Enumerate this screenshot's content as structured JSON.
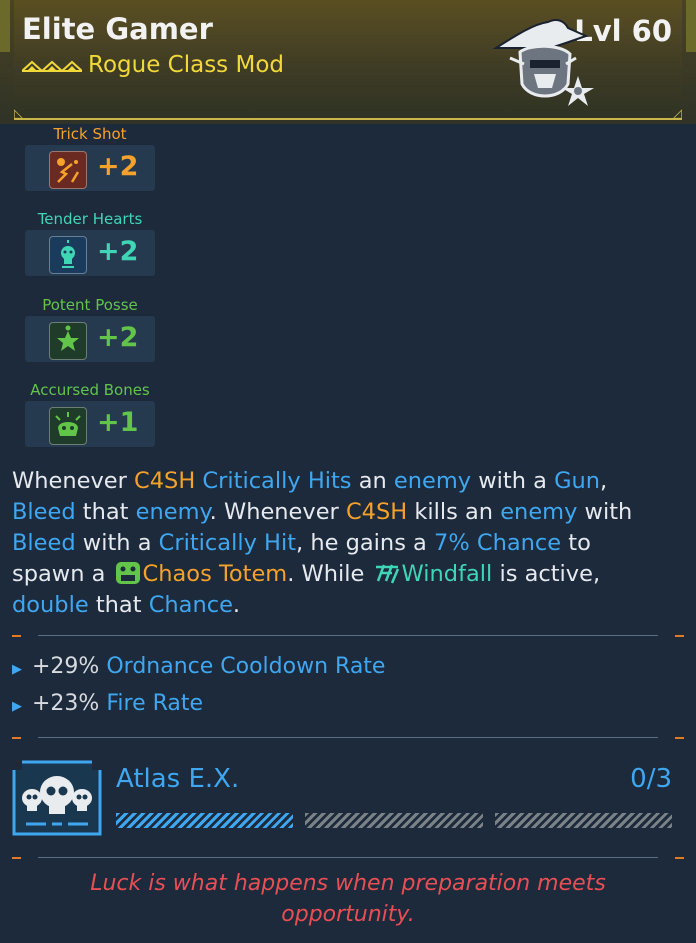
{
  "header": {
    "item_name": "Elite Gamer",
    "item_type": "Rogue Class Mod",
    "level": "Lvl 60",
    "rarity_icon": "chevron-rarity-icon",
    "portrait_icon": "robot-cowboy-portrait-icon",
    "accent_color": "#f1d93a"
  },
  "skills": [
    {
      "name": "Trick Shot",
      "value": "+2",
      "icon": "trick-shot-icon",
      "color": "#f6a12a"
    },
    {
      "name": "Tender Hearts",
      "value": "+2",
      "icon": "tender-hearts-icon",
      "color": "#3fd6b6"
    },
    {
      "name": "Potent Posse",
      "value": "+2",
      "icon": "potent-posse-icon",
      "color": "#62c54a"
    },
    {
      "name": "Accursed Bones",
      "value": "+1",
      "icon": "accursed-bones-icon",
      "color": "#62c54a"
    }
  ],
  "description": {
    "parts": [
      "Whenever ",
      "C4SH",
      " ",
      "Critically Hits",
      " an ",
      "enemy",
      " with a ",
      "Gun",
      ",",
      "Bleed",
      " that ",
      "enemy",
      ". Whenever ",
      "C4SH",
      " kills an ",
      "enemy",
      " with",
      "Bleed",
      " with a ",
      "Critically Hit",
      ", he gains a ",
      "7% Chance",
      " to",
      "spawn a ",
      "Chaos Totem",
      ". While ",
      "Windfall",
      " is active,",
      "double",
      " that ",
      "Chance",
      "."
    ]
  },
  "stats": [
    {
      "value": "+29%",
      "label": "Ordnance Cooldown Rate"
    },
    {
      "value": "+23%",
      "label": "Fire Rate"
    }
  ],
  "atlas": {
    "name": "Atlas E.X.",
    "progress_text": "0/3",
    "filled_segments": 1,
    "total_segments": 3,
    "icon": "skulls-icon"
  },
  "flavor_text": {
    "line1": "Luck is what happens when preparation meets",
    "line2": "opportunity."
  },
  "colors": {
    "keyword": "#3fa7f0",
    "character": "#f6a12a",
    "flavor": "#e84f54"
  }
}
